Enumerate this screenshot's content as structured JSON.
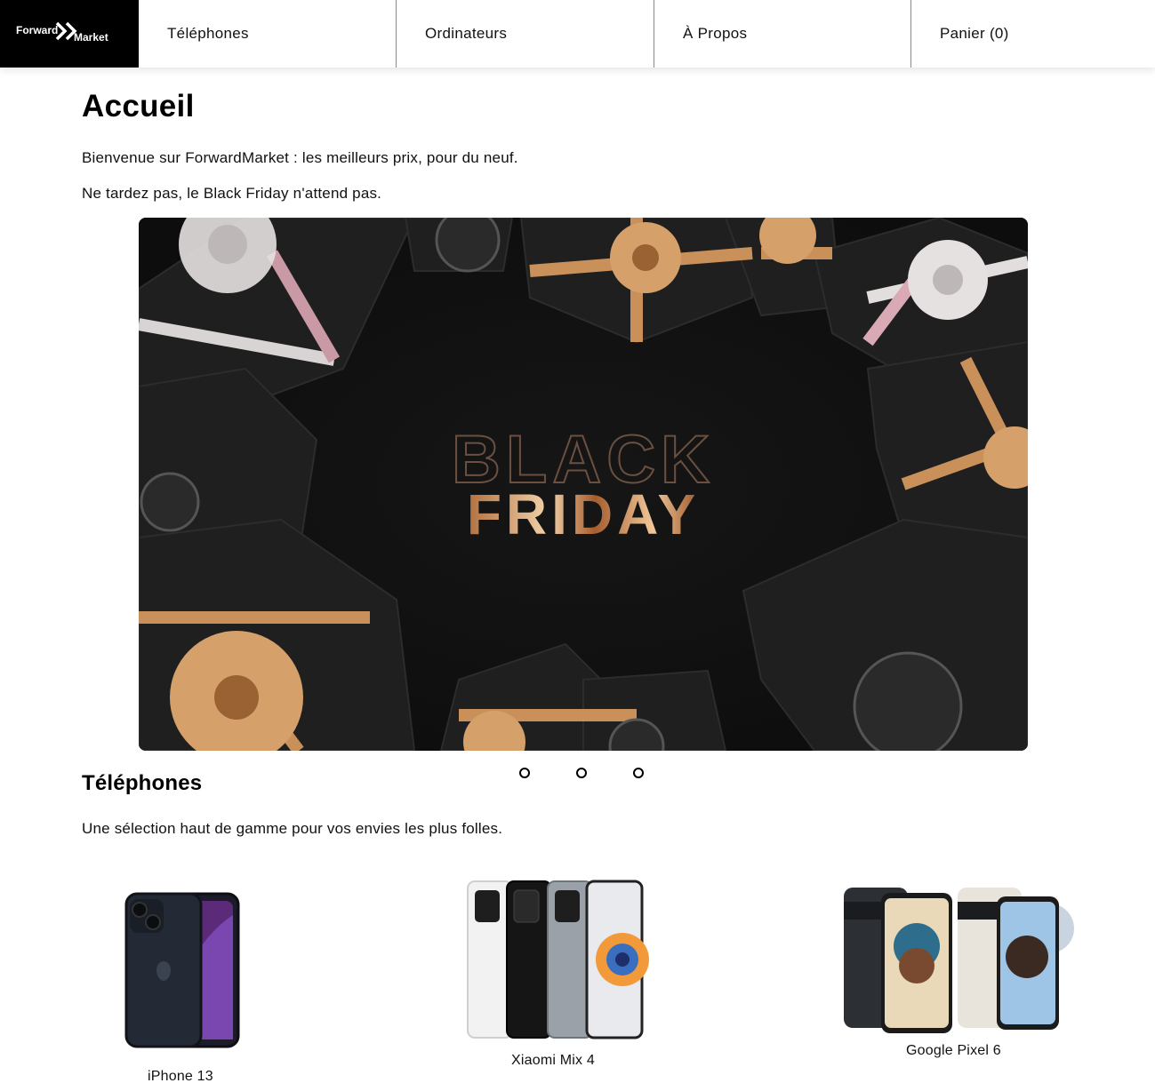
{
  "brand": {
    "part1": "Forward",
    "part2": "Market"
  },
  "nav": {
    "items": [
      {
        "label": "Téléphones"
      },
      {
        "label": "Ordinateurs"
      },
      {
        "label": "À Propos"
      },
      {
        "label": "Panier (0)"
      }
    ]
  },
  "home": {
    "title": "Accueil",
    "intro": "Bienvenue sur ForwardMarket : les meilleurs prix, pour du neuf.",
    "promo": "Ne tardez pas, le Black Friday n'attend pas."
  },
  "carousel": {
    "slide_text_line1": "BLACK",
    "slide_text_line2": "FRIDAY",
    "dot_count": 3
  },
  "phones": {
    "title": "Téléphones",
    "subtitle": "Une sélection haut de gamme pour vos envies les plus folles.",
    "products": [
      {
        "name": "iPhone 13"
      },
      {
        "name": "Xiaomi Mix 4"
      },
      {
        "name": "Google Pixel 6"
      }
    ]
  },
  "colors": {
    "gold": "#c9905a",
    "dark": "#151515",
    "silver": "#d9d4d4"
  }
}
